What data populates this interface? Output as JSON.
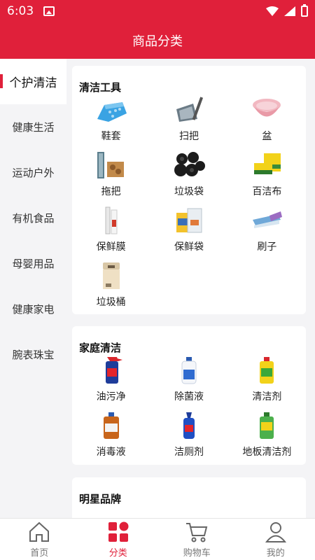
{
  "status": {
    "time": "6:03"
  },
  "header": {
    "title": "商品分类"
  },
  "sidebar": {
    "items": [
      {
        "label": "个护清洁",
        "active": true
      },
      {
        "label": "健康生活"
      },
      {
        "label": "运动户外"
      },
      {
        "label": "有机食品"
      },
      {
        "label": "母婴用品"
      },
      {
        "label": "健康家电"
      },
      {
        "label": "腕表珠宝"
      }
    ]
  },
  "sections": [
    {
      "title": "清洁工具",
      "items": [
        {
          "label": "鞋套",
          "icon": "shoe-cover-icon"
        },
        {
          "label": "扫把",
          "icon": "broom-icon"
        },
        {
          "label": "盆",
          "icon": "basin-icon"
        },
        {
          "label": "拖把",
          "icon": "mop-icon"
        },
        {
          "label": "垃圾袋",
          "icon": "garbage-bag-icon"
        },
        {
          "label": "百洁布",
          "icon": "scouring-pad-icon"
        },
        {
          "label": "保鲜膜",
          "icon": "cling-film-icon"
        },
        {
          "label": "保鲜袋",
          "icon": "freshness-bag-icon"
        },
        {
          "label": "刷子",
          "icon": "brush-icon"
        },
        {
          "label": "垃圾桶",
          "icon": "trash-can-icon"
        }
      ]
    },
    {
      "title": "家庭清洁",
      "items": [
        {
          "label": "油污净",
          "icon": "degreaser-icon"
        },
        {
          "label": "除菌液",
          "icon": "disinfectant-bottle-icon"
        },
        {
          "label": "清洁剂",
          "icon": "detergent-icon"
        },
        {
          "label": "消毒液",
          "icon": "sanitizer-icon"
        },
        {
          "label": "洁厕剂",
          "icon": "toilet-cleaner-icon"
        },
        {
          "label": "地板清洁剂",
          "icon": "floor-cleaner-icon"
        }
      ]
    },
    {
      "title": "明星品牌"
    }
  ],
  "tabbar": {
    "items": [
      {
        "label": "首页",
        "icon": "home-icon"
      },
      {
        "label": "分类",
        "icon": "category-icon",
        "active": true
      },
      {
        "label": "购物车",
        "icon": "cart-icon"
      },
      {
        "label": "我的",
        "icon": "profile-icon"
      }
    ]
  },
  "colors": {
    "accent": "#e0203a",
    "background": "#f4f4f6"
  }
}
